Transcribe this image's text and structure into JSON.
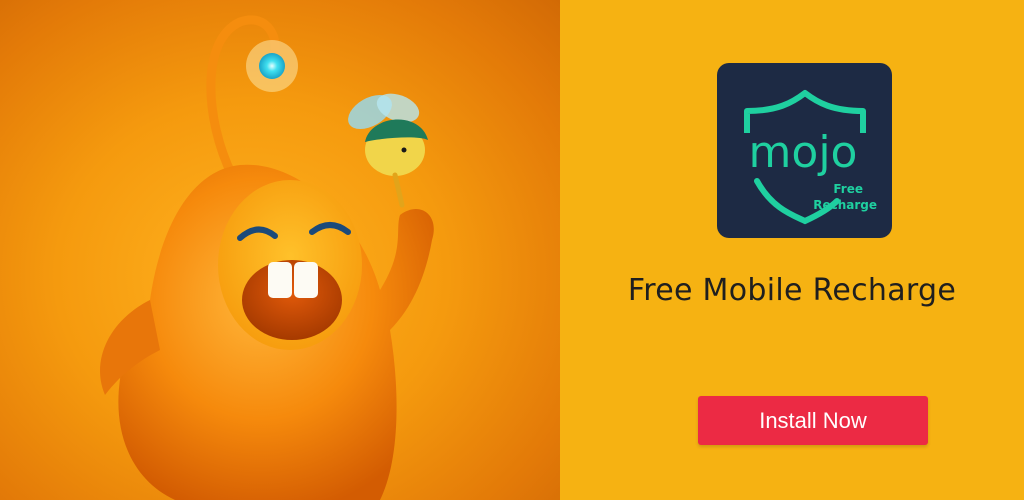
{
  "banner": {
    "headline": "Free Mobile Recharge",
    "install_label": "Install Now"
  },
  "app_icon": {
    "logo_word": "mojo",
    "tag_line1": "Free",
    "tag_line2": "Recharge",
    "icon": "mojo-shield-logo"
  },
  "illustration": {
    "subject": "orange mascot with antenna holding green bird"
  },
  "colors": {
    "art_background": "#f59a0e",
    "promo_background": "#f6b212",
    "button": "#ec2a44",
    "icon_background": "#1d2a44",
    "logo_accent": "#1fd0a0"
  }
}
